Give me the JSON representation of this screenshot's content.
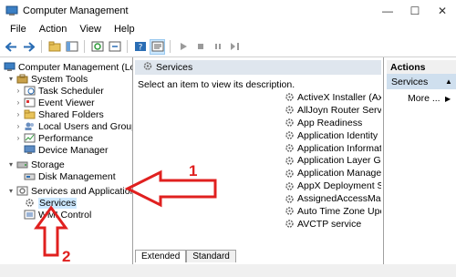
{
  "window": {
    "title": "Computer Management"
  },
  "window_controls": {
    "minimize": "—",
    "maximize": "☐",
    "close": "✕"
  },
  "menu": [
    "File",
    "Action",
    "View",
    "Help"
  ],
  "tree": {
    "root": "Computer Management (Local",
    "system_tools": "System Tools",
    "task_scheduler": "Task Scheduler",
    "event_viewer": "Event Viewer",
    "shared_folders": "Shared Folders",
    "local_users": "Local Users and Groups",
    "performance": "Performance",
    "device_manager": "Device Manager",
    "storage": "Storage",
    "disk_management": "Disk Management",
    "services_apps": "Services and Applications",
    "services": "Services",
    "wmi": "WMI Control"
  },
  "middle": {
    "header": "Services",
    "description": "Select an item to view its description.",
    "services": [
      "ActiveX Installer (Axl",
      "AllJoyn Router Servic",
      "App Readiness",
      "Application Identity",
      "Application Informat",
      "Application Layer Ga",
      "Application Manage",
      "AppX Deployment S",
      "AssignedAccessMan",
      "Auto Time Zone Upc",
      "AVCTP service"
    ],
    "tabs": {
      "extended": "Extended",
      "standard": "Standard"
    }
  },
  "actions": {
    "header": "Actions",
    "section": "Services",
    "more": "More ..."
  },
  "annotations": {
    "label1": "1",
    "label2": "2",
    "color": "#e0201f"
  },
  "colors": {
    "header_bg": "#dfe6ee",
    "selected_bg": "#cce8ff",
    "actions_selected_bg": "#cfdfee"
  }
}
